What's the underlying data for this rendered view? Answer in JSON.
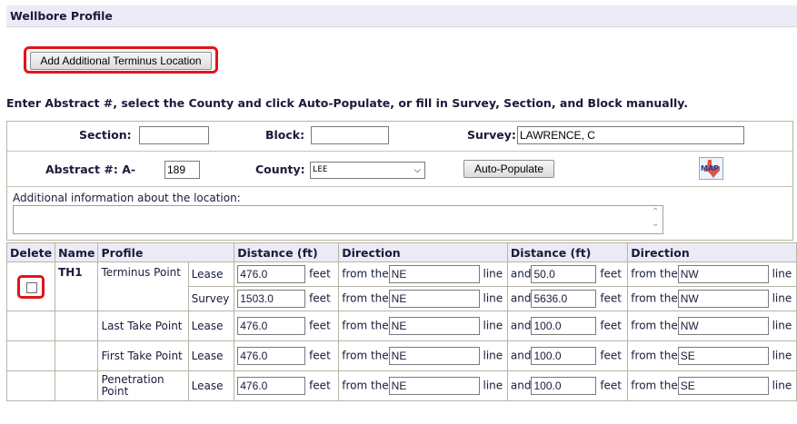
{
  "header": {
    "title": "Wellbore Profile"
  },
  "add_button": {
    "label": "Add Additional Terminus Location"
  },
  "instructions": "Enter Abstract #, select the County and click Auto-Populate, or fill in Survey, Section, and Block manually.",
  "location": {
    "section_label": "Section:",
    "section_value": "",
    "block_label": "Block:",
    "block_value": "",
    "survey_label": "Survey:",
    "survey_value": "LAWRENCE, C",
    "abstract_label": "Abstract #: A-",
    "abstract_value": "189",
    "county_label": "County:",
    "county_value": "LEE",
    "auto_populate_label": "Auto-Populate",
    "map_icon_text": "MAP",
    "additional_info_label": "Additional information about the location:",
    "additional_info_value": ""
  },
  "table": {
    "headers": {
      "delete": "Delete",
      "name": "Name",
      "profile": "Profile",
      "distance1": "Distance (ft)",
      "direction1": "Direction",
      "distance2": "Distance (ft)",
      "direction2": "Direction"
    },
    "words": {
      "feet": "feet",
      "from_the": "from the",
      "line": "line",
      "and": "and"
    },
    "rows": [
      {
        "name": "TH1",
        "profile": "Terminus Point",
        "type": "Lease",
        "dist1": "476.0",
        "dir1": "NE",
        "dist2": "50.0",
        "dir2": "NW"
      },
      {
        "name": "",
        "profile": "",
        "type": "Survey",
        "dist1": "1503.0",
        "dir1": "NE",
        "dist2": "5636.0",
        "dir2": "NW"
      },
      {
        "name": "",
        "profile": "Last Take Point",
        "type": "Lease",
        "dist1": "476.0",
        "dir1": "NE",
        "dist2": "100.0",
        "dir2": "NW"
      },
      {
        "name": "",
        "profile": "First Take Point",
        "type": "Lease",
        "dist1": "476.0",
        "dir1": "NE",
        "dist2": "100.0",
        "dir2": "SE"
      },
      {
        "name": "",
        "profile": "Penetration Point",
        "type": "Lease",
        "dist1": "476.0",
        "dir1": "NE",
        "dist2": "100.0",
        "dir2": "SE"
      }
    ]
  },
  "colors": {
    "highlight": "#e0151b",
    "header_bg": "#ecebf5",
    "border": "#b9b3a6"
  }
}
